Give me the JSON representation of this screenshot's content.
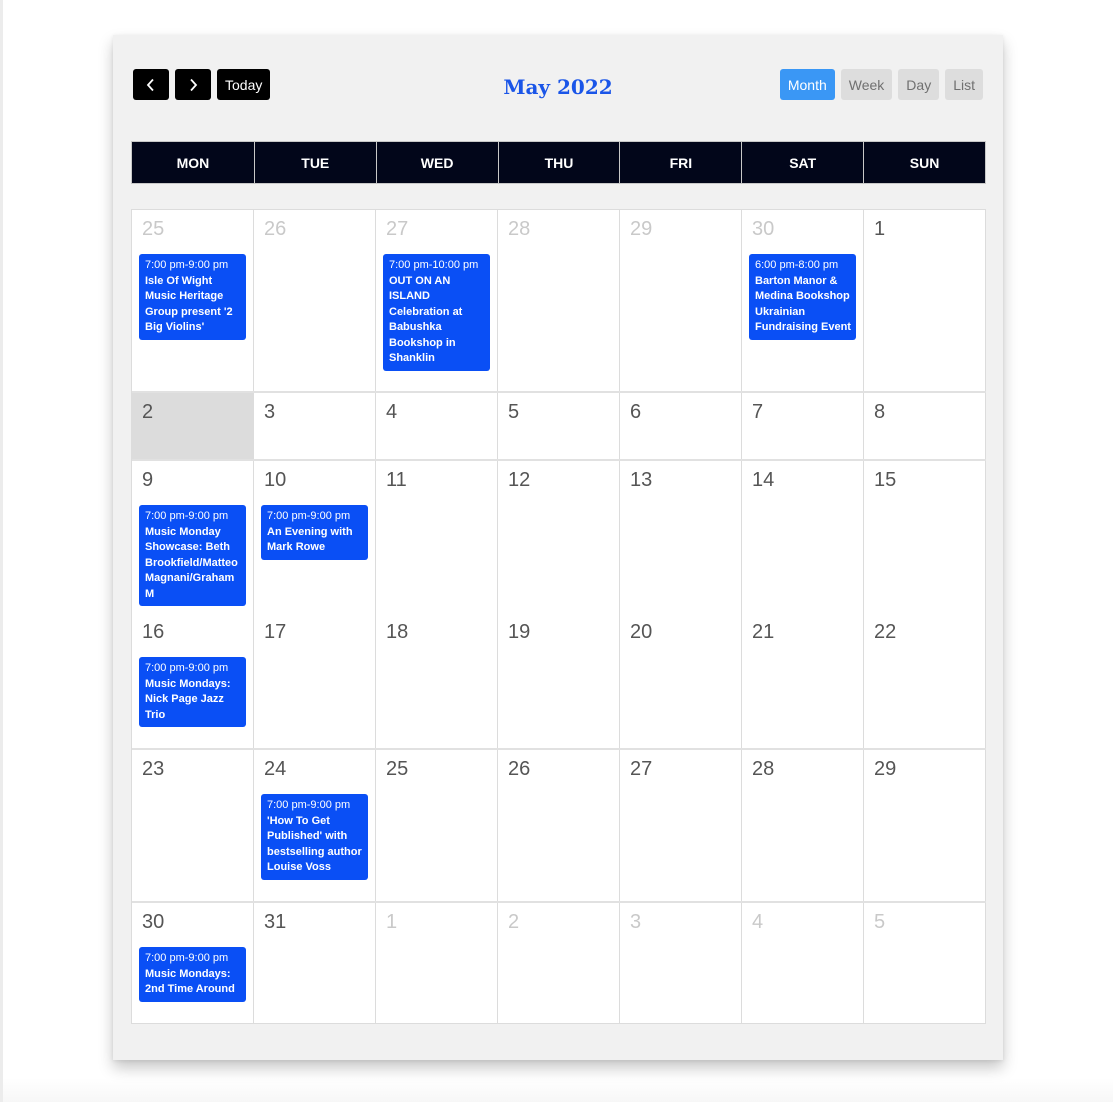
{
  "header": {
    "title": "May 2022",
    "prev_label": "previous",
    "next_label": "next",
    "today_label": "Today",
    "views": [
      {
        "label": "Month",
        "active": true
      },
      {
        "label": "Week",
        "active": false
      },
      {
        "label": "Day",
        "active": false
      },
      {
        "label": "List",
        "active": false
      }
    ]
  },
  "colors": {
    "accent": "#1a55e8",
    "event": "#0a4ff5",
    "active_view": "#3a97f5",
    "header_row": "#02061a",
    "today": "#dcdcdc"
  },
  "weekdays": [
    "MON",
    "TUE",
    "WED",
    "THU",
    "FRI",
    "SAT",
    "SUN"
  ],
  "weeks": [
    [
      {
        "day": "25",
        "other": true,
        "events": [
          {
            "time": "7:00 pm-9:00 pm",
            "title": "Isle Of Wight Music Heritage Group present '2 Big Violins'"
          }
        ]
      },
      {
        "day": "26",
        "other": true,
        "events": []
      },
      {
        "day": "27",
        "other": true,
        "events": [
          {
            "time": "7:00 pm-10:00 pm",
            "title": "OUT ON AN ISLAND Celebration at Babushka Bookshop in Shanklin"
          }
        ]
      },
      {
        "day": "28",
        "other": true,
        "events": []
      },
      {
        "day": "29",
        "other": true,
        "events": []
      },
      {
        "day": "30",
        "other": true,
        "events": [
          {
            "time": "6:00 pm-8:00 pm",
            "title": "Barton Manor & Medina Bookshop Ukrainian Fundraising Event"
          }
        ]
      },
      {
        "day": "1",
        "other": false,
        "events": []
      }
    ],
    [
      {
        "day": "2",
        "other": false,
        "today": true,
        "events": []
      },
      {
        "day": "3",
        "other": false,
        "events": []
      },
      {
        "day": "4",
        "other": false,
        "events": []
      },
      {
        "day": "5",
        "other": false,
        "events": []
      },
      {
        "day": "6",
        "other": false,
        "events": []
      },
      {
        "day": "7",
        "other": false,
        "events": []
      },
      {
        "day": "8",
        "other": false,
        "events": []
      }
    ],
    [
      {
        "day": "9",
        "other": false,
        "events": [
          {
            "time": "7:00 pm-9:00 pm",
            "title": "Music Monday Showcase: Beth Brookfield/Matteo Magnani/GrahamM"
          }
        ]
      },
      {
        "day": "10",
        "other": false,
        "events": [
          {
            "time": "7:00 pm-9:00 pm",
            "title": "An Evening with Mark Rowe"
          }
        ]
      },
      {
        "day": "11",
        "other": false,
        "events": []
      },
      {
        "day": "12",
        "other": false,
        "events": []
      },
      {
        "day": "13",
        "other": false,
        "events": []
      },
      {
        "day": "14",
        "other": false,
        "events": []
      },
      {
        "day": "15",
        "other": false,
        "events": []
      }
    ],
    [
      {
        "day": "16",
        "other": false,
        "events": [
          {
            "time": "7:00 pm-9:00 pm",
            "title": "Music Mondays: Nick Page Jazz Trio"
          }
        ]
      },
      {
        "day": "17",
        "other": false,
        "events": []
      },
      {
        "day": "18",
        "other": false,
        "events": []
      },
      {
        "day": "19",
        "other": false,
        "events": []
      },
      {
        "day": "20",
        "other": false,
        "events": []
      },
      {
        "day": "21",
        "other": false,
        "events": []
      },
      {
        "day": "22",
        "other": false,
        "events": []
      }
    ],
    [
      {
        "day": "23",
        "other": false,
        "events": []
      },
      {
        "day": "24",
        "other": false,
        "events": [
          {
            "time": "7:00 pm-9:00 pm",
            "title": "'How To Get Published' with bestselling author Louise Voss"
          }
        ]
      },
      {
        "day": "25",
        "other": false,
        "events": []
      },
      {
        "day": "26",
        "other": false,
        "events": []
      },
      {
        "day": "27",
        "other": false,
        "events": []
      },
      {
        "day": "28",
        "other": false,
        "events": []
      },
      {
        "day": "29",
        "other": false,
        "events": []
      }
    ],
    [
      {
        "day": "30",
        "other": false,
        "events": [
          {
            "time": "7:00 pm-9:00 pm",
            "title": "Music Mondays: 2nd Time Around"
          }
        ]
      },
      {
        "day": "31",
        "other": false,
        "events": []
      },
      {
        "day": "1",
        "other": true,
        "events": []
      },
      {
        "day": "2",
        "other": true,
        "events": []
      },
      {
        "day": "3",
        "other": true,
        "events": []
      },
      {
        "day": "4",
        "other": true,
        "events": []
      },
      {
        "day": "5",
        "other": true,
        "events": []
      }
    ]
  ]
}
